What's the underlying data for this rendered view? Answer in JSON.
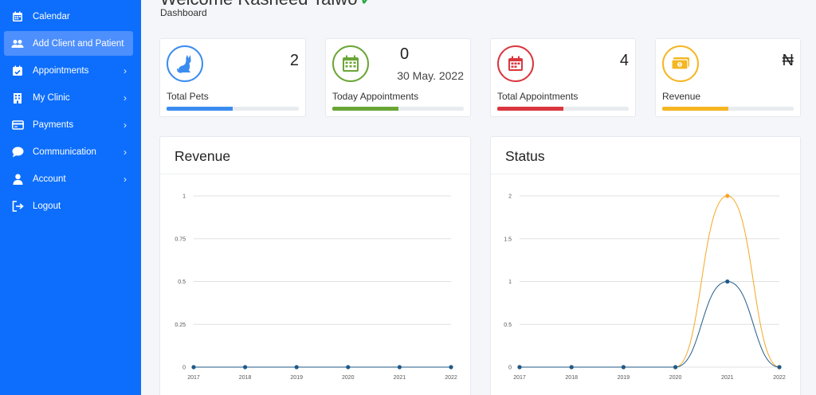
{
  "sidebar": {
    "items": [
      {
        "label": "Calendar",
        "icon": "calendar-icon",
        "chevron": ""
      },
      {
        "label": "Add Client and Patient",
        "icon": "users-icon",
        "chevron": ""
      },
      {
        "label": "Appointments",
        "icon": "calendar-check-icon",
        "chevron": "›"
      },
      {
        "label": "My Clinic",
        "icon": "building-icon",
        "chevron": "›"
      },
      {
        "label": "Payments",
        "icon": "credit-card-icon",
        "chevron": "›"
      },
      {
        "label": "Communication",
        "icon": "chat-icon",
        "chevron": "›"
      },
      {
        "label": "Account",
        "icon": "user-icon",
        "chevron": "›"
      },
      {
        "label": "Logout",
        "icon": "logout-icon",
        "chevron": ""
      }
    ],
    "active_index": 1
  },
  "header": {
    "title": "Welcome Rasheed Taiwo",
    "subtitle": "Dashboard"
  },
  "stats": [
    {
      "label": "Total Pets",
      "value": "2",
      "icon": "cat-icon",
      "color": "#3b8cf0",
      "progress_percent": 50
    },
    {
      "label": "Today Appointments",
      "value": "0",
      "date": "30 May. 2022",
      "icon": "calendar-grid-icon",
      "color": "#6aa636",
      "progress_percent": 50
    },
    {
      "label": "Total Appointments",
      "value": "4",
      "icon": "calendar-icon",
      "color": "#d9363e",
      "progress_percent": 50
    },
    {
      "label": "Revenue",
      "value": "₦",
      "icon": "money-icon",
      "color": "#f5b622",
      "progress_percent": 50
    }
  ],
  "chart_data": [
    {
      "type": "line",
      "title": "Revenue",
      "x": [
        "2017",
        "2018",
        "2019",
        "2020",
        "2021",
        "2022"
      ],
      "ylim": [
        0,
        1
      ],
      "yticks": [
        "1",
        "0.75",
        "0.5",
        "0.25",
        "0"
      ],
      "grid": true,
      "series": [
        {
          "values": [
            0,
            0,
            0,
            0,
            0,
            0
          ],
          "color": "#1f5a8a"
        }
      ]
    },
    {
      "type": "line",
      "title": "Status",
      "x": [
        "2017",
        "2018",
        "2019",
        "2020",
        "2021",
        "2022"
      ],
      "ylim": [
        0,
        2
      ],
      "yticks": [
        "2",
        "1.5",
        "1",
        "0.5",
        "0"
      ],
      "grid": true,
      "series": [
        {
          "values": [
            0,
            0,
            0,
            0,
            2,
            0
          ],
          "color": "#f5a623"
        },
        {
          "values": [
            0,
            0,
            0,
            0,
            1,
            0
          ],
          "color": "#1f5a8a"
        }
      ]
    }
  ]
}
